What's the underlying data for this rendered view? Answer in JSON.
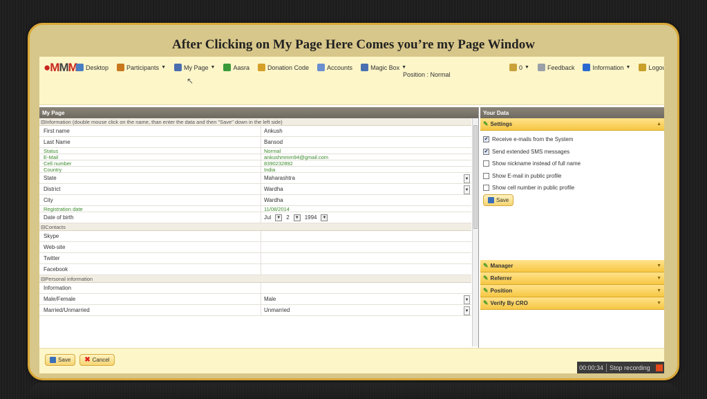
{
  "slide": {
    "title": "After Clicking on My Page Here Comes you’re my Page Window"
  },
  "topbar": {
    "logo": {
      "part1": "M",
      "part2": "M",
      "part3": "M"
    },
    "nav": [
      {
        "label": "Desktop",
        "icon": "desktop-icon",
        "color": "#4a7ec2"
      },
      {
        "label": "Participants",
        "icon": "participants-icon",
        "color": "#c8771d",
        "dropdown": true
      },
      {
        "label": "My Page",
        "icon": "user-icon",
        "color": "#4a6fb0",
        "dropdown": true
      },
      {
        "label": "Aasra",
        "icon": "aasra-icon",
        "color": "#3a9a3a"
      },
      {
        "label": "Donation Code",
        "icon": "donation-icon",
        "color": "#d4a02a"
      },
      {
        "label": "Accounts",
        "icon": "accounts-icon",
        "color": "#6a8fd0"
      },
      {
        "label": "Magic Box",
        "icon": "magic-box-icon",
        "color": "#4a6fb0",
        "dropdown": true
      }
    ],
    "position": "Position : Normal",
    "right_nav": [
      {
        "label": "0",
        "icon": "messages-icon",
        "color": "#c9a23a",
        "dropdown": true
      },
      {
        "label": "Feedback",
        "icon": "feedback-icon",
        "color": "#9aa0a8"
      },
      {
        "label": "Information",
        "icon": "info-icon",
        "color": "#2a6ad0",
        "dropdown": true
      },
      {
        "label": "Logout",
        "icon": "logout-icon",
        "color": "#c8a02a"
      }
    ]
  },
  "main": {
    "header": "My Page",
    "groups": {
      "information": "Information (double mouse click on the name, than enter the data and then \"Save\" down in the left side)",
      "contacts": "Contacts",
      "personal": "Personal information"
    },
    "info_rows": [
      {
        "label": "First name",
        "value": "Ankush",
        "style": "h16"
      },
      {
        "label": "Last Name",
        "value": "Bansod",
        "style": "h16"
      },
      {
        "label": "Status",
        "value": "Normal",
        "style": "h9 green"
      },
      {
        "label": "E-Mail",
        "value": "ankushmmm94@gmail.com",
        "style": "h9 green",
        "bold": true
      },
      {
        "label": "Cell number",
        "value": "8390232892",
        "style": "h9 green"
      },
      {
        "label": "Country",
        "value": "India",
        "style": "h9 green"
      }
    ],
    "state": {
      "label": "State",
      "value": "Maharashtra"
    },
    "district": {
      "label": "District",
      "value": "Wardha"
    },
    "city": {
      "label": "City",
      "value": "Wardha"
    },
    "registration": {
      "label": "Registration date",
      "value": "11/08/2014"
    },
    "dob": {
      "label": "Date of birth",
      "month": "Jul",
      "day": "2",
      "year": "1994"
    },
    "contacts": [
      "Skype",
      "Web-site",
      "Twitter",
      "Facebook"
    ],
    "personal": {
      "information": "Information",
      "gender": {
        "label": "Male/Female",
        "value": "Male"
      },
      "married": {
        "label": "Married/Unmarried",
        "value": "Unmarried"
      }
    }
  },
  "side": {
    "header": "Your Data",
    "settings": {
      "title": "Settings",
      "options": [
        {
          "label": "Receive e-mails from the System",
          "checked": true
        },
        {
          "label": "Send extended SMS messages",
          "checked": true
        },
        {
          "label": "Show nickname instead of full name",
          "checked": false
        },
        {
          "label": "Show E-mail in public profile",
          "checked": false
        },
        {
          "label": "Show cell number in public profile",
          "checked": false
        }
      ],
      "save": "Save"
    },
    "sections": [
      "Manager",
      "Referrer",
      "Position",
      "Verify By CRO"
    ]
  },
  "footer": {
    "save": "Save",
    "cancel": "Cancel",
    "recorder_time": "00:00:34",
    "recorder_stop": "Stop recording"
  }
}
